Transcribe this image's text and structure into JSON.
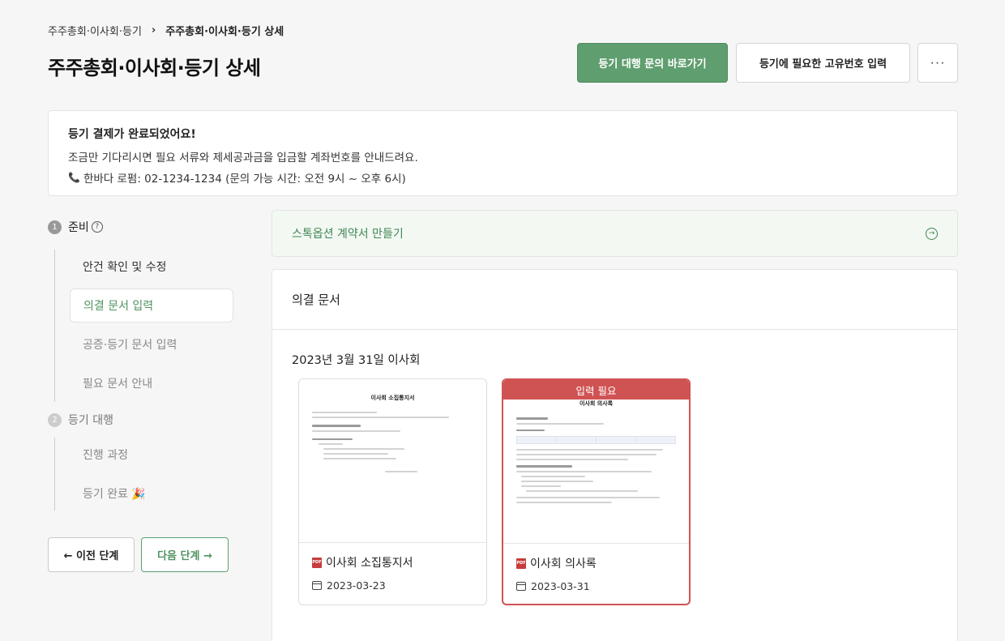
{
  "breadcrumb": {
    "parent": "주주총회·이사회·등기",
    "separator": "›",
    "current": "주주총회·이사회·등기 상세"
  },
  "page_title": "주주총회·이사회·등기 상세",
  "header_actions": {
    "primary_label": "등기 대행 문의 바로가기",
    "secondary_label": "등기에 필요한 고유번호 입력",
    "more_label": "···"
  },
  "notice": {
    "title": "등기 결제가 완료되었어요!",
    "message": "조금만 기다리시면 필요 서류와 제세공과금을 입금할 계좌번호를 안내드려요.",
    "phone_line": "한바다 로펌: 02-1234-1234 (문의 가능 시간: 오전 9시 ~ 오후 6시)"
  },
  "steps": {
    "step1": {
      "number": "1",
      "label": "준비",
      "items": [
        "안건 확인 및 수정",
        "의결 문서 입력",
        "공증·등기 문서 입력",
        "필요 문서 안내"
      ]
    },
    "step2": {
      "number": "2",
      "label": "등기 대행",
      "items": [
        "진행 과정",
        "등기 완료 🎉"
      ]
    }
  },
  "nav": {
    "prev_label": "← 이전 단계",
    "next_label": "다음 단계 →"
  },
  "option_bar": {
    "label": "스톡옵션 계약서 만들기"
  },
  "docs": {
    "header": "의결 문서",
    "meeting_title": "2023년 3월 31일 이사회",
    "cards": [
      {
        "preview_title": "이사회 소집통지서",
        "name": "이사회 소집통지서",
        "date": "2023-03-23",
        "badge": ""
      },
      {
        "preview_title": "이사회 의사록",
        "name": "이사회 의사록",
        "date": "2023-03-31",
        "badge": "입력 필요"
      }
    ]
  },
  "colors": {
    "accent_green": "#5f9e6e",
    "alert_red": "#d05353"
  }
}
